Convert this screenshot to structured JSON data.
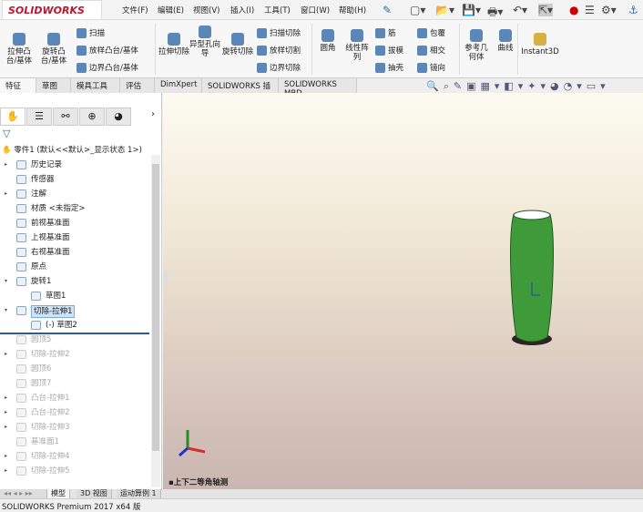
{
  "app": {
    "logo": "SOLIDWORKS"
  },
  "menu": [
    "文件(F)",
    "编辑(E)",
    "视图(V)",
    "插入(I)",
    "工具(T)",
    "窗口(W)",
    "帮助(H)"
  ],
  "ribbon": {
    "big": [
      "拉伸凸台/基体",
      "旋转凸台/基体",
      "拉伸切除",
      "异型孔向导",
      "旋转切除",
      "圆角",
      "线性阵列",
      "参考几何体",
      "曲线",
      "Instant3D"
    ],
    "small": [
      "扫描",
      "放样凸台/基体",
      "边界凸台/基体",
      "扫描切除",
      "放样切割",
      "边界切除",
      "筋",
      "拔模",
      "抽壳",
      "包覆",
      "相交",
      "镜向"
    ]
  },
  "tabs": [
    "特征",
    "草图",
    "模具工具",
    "评估",
    "DimXpert",
    "SOLIDWORKS 插件",
    "SOLIDWORKS MBD"
  ],
  "tree": {
    "root": "零件1 (默认<<默认>_显示状态 1>)",
    "items": [
      {
        "label": "历史记录",
        "expand": true
      },
      {
        "label": "传感器"
      },
      {
        "label": "注解",
        "expand": true
      },
      {
        "label": "材质 <未指定>"
      },
      {
        "label": "前视基准面"
      },
      {
        "label": "上视基准面"
      },
      {
        "label": "右视基准面"
      },
      {
        "label": "原点"
      },
      {
        "label": "旋转1",
        "open": true
      },
      {
        "label": "草图1",
        "child": true
      },
      {
        "label": "切除-拉伸1",
        "open": true,
        "selected": true
      },
      {
        "label": "(-) 草图2",
        "child": true
      },
      {
        "label": "圆顶5",
        "dim": true
      },
      {
        "label": "切除-拉伸2",
        "dim": true,
        "expand": true
      },
      {
        "label": "圆顶6",
        "dim": true
      },
      {
        "label": "圆顶7",
        "dim": true
      },
      {
        "label": "凸台-拉伸1",
        "dim": true,
        "expand": true
      },
      {
        "label": "凸台-拉伸2",
        "dim": true,
        "expand": true
      },
      {
        "label": "切除-拉伸3",
        "dim": true,
        "expand": true
      },
      {
        "label": "基准面1",
        "dim": true
      },
      {
        "label": "切除-拉伸4",
        "dim": true,
        "expand": true
      },
      {
        "label": "切除-拉伸5",
        "dim": true,
        "expand": true
      }
    ]
  },
  "viewport": {
    "view_label": "上下二等角轴测",
    "model_color": "#3f9a3a"
  },
  "bottom_tabs": [
    "模型",
    "3D 视图",
    "运动算例 1"
  ],
  "status": "SOLIDWORKS Premium 2017 x64 版"
}
